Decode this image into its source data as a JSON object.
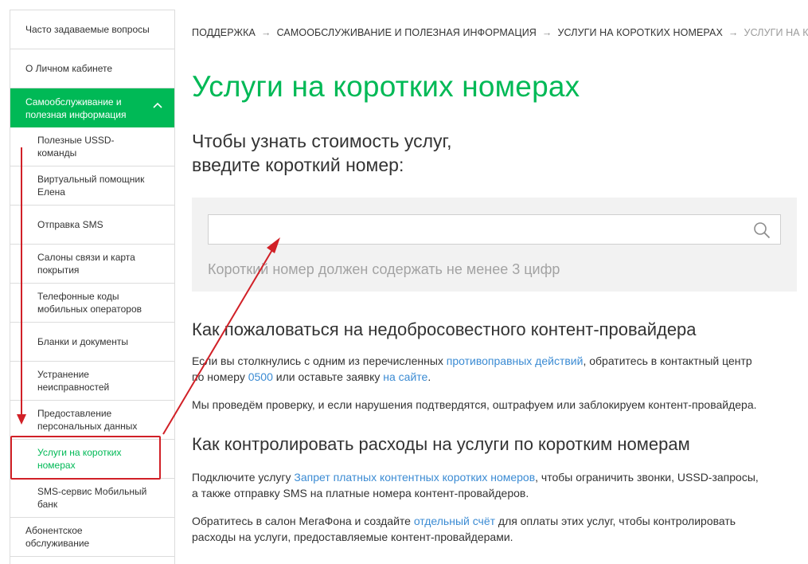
{
  "sidebar": {
    "items": [
      {
        "label": "Часто задаваемые вопросы"
      },
      {
        "label": "О Личном кабинете"
      },
      {
        "label": "Самообслуживание и полезная информация"
      }
    ],
    "subitems": [
      {
        "label": "Полезные USSD-команды"
      },
      {
        "label": "Виртуальный помощник Елена"
      },
      {
        "label": "Отправка SMS"
      },
      {
        "label": "Салоны связи и карта покрытия"
      },
      {
        "label": "Телефонные коды мобильных операторов"
      },
      {
        "label": "Бланки и документы"
      },
      {
        "label": "Устранение неисправностей"
      },
      {
        "label": "Предоставление персональных данных"
      },
      {
        "label": "Услуги на коротких номерах"
      },
      {
        "label": "SMS-сервис Мобильный банк"
      }
    ],
    "bottom_item": {
      "label": "Абонентское обслуживание"
    }
  },
  "breadcrumb": {
    "items": [
      "Поддержка",
      "Самообслуживание и полезная информация",
      "Услуги на коротких номерах",
      "Услуги на корот"
    ],
    "separator": "→"
  },
  "page": {
    "title": "Услуги на коротких номерах",
    "subtitle_line1": "Чтобы узнать стоимость услуг,",
    "subtitle_line2": "введите короткий номер:"
  },
  "search": {
    "value": "",
    "placeholder": "",
    "hint": "Короткий номер должен содержать не менее 3 цифр",
    "icon": "search-icon"
  },
  "section1": {
    "heading": "Как пожаловаться на недобросовестного контент-провайдера",
    "p1_part1": "Если вы столкнулись с одним из перечисленных ",
    "p1_link1": "противоправных действий",
    "p1_part2": ", обратитесь в контактный центр",
    "p1_part3": "по номеру ",
    "p1_link2": "0500",
    "p1_part4": " или оставьте заявку ",
    "p1_link3": "на сайте",
    "p1_part5": ".",
    "p2": "Мы проведём проверку, и если нарушения подтвердятся, оштрафуем или заблокируем контент-провайдера."
  },
  "section2": {
    "heading": "Как контролировать расходы на услуги по коротким номерам",
    "p1_part1": "Подключите услугу ",
    "p1_link1": "Запрет платных контентных коротких номеров",
    "p1_part2": ", чтобы ограничить звонки, USSD-запросы,",
    "p1_line2": "а также отправку SMS на платные номера контент-провайдеров.",
    "p2_part1": "Обратитесь в салон МегаФона и создайте ",
    "p2_link1": "отдельный счёт",
    "p2_part2": " для оплаты этих услуг, чтобы контролировать",
    "p2_line2": "расходы на услуги, предоставляемые контент-провайдерами."
  },
  "colors": {
    "brand_green": "#00b956",
    "link_blue": "#3b8bd3",
    "annotation_red": "#d12027",
    "panel_gray": "#f2f2f2"
  }
}
